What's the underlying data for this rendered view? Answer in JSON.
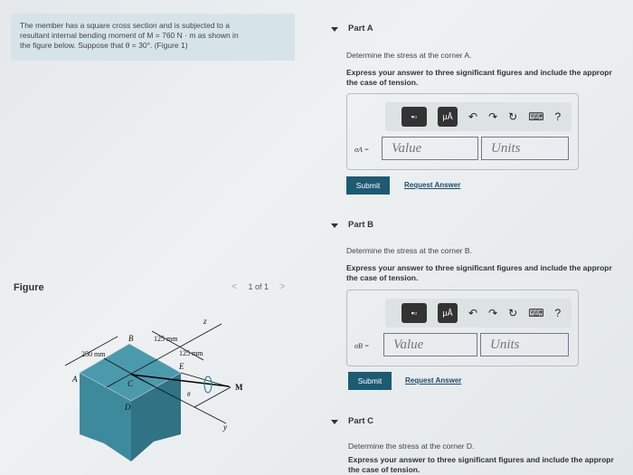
{
  "problem": {
    "text_line1": "The member has a square cross section and is subjected to a",
    "text_line2": "resultant internal bending moment of M = 760  N · m as shown in",
    "text_line3": "the figure below. Suppose that θ = 30°. (Figure 1)"
  },
  "figure": {
    "label": "Figure",
    "pager": "1 of 1",
    "labels": {
      "A": "A",
      "B": "B",
      "C": "C",
      "D": "D",
      "E": "E",
      "M": "M",
      "z": "z",
      "y": "y",
      "theta": "θ",
      "dim1": "250 mm",
      "dim2": "125 mm",
      "dim3": "125 mm"
    },
    "block_color": "#3d8a9c"
  },
  "toolbar": {
    "templates": "templates",
    "symbols": "μÅ",
    "undo": "↶",
    "redo": "↷",
    "reset": "↻",
    "keyboard": "⌨",
    "help": "?"
  },
  "parts": [
    {
      "title": "Part A",
      "question": "Determine the stress at the corner A.",
      "instructions_1": "Express your answer to three significant figures and include the appropr",
      "instructions_2": "the case of tension.",
      "var": "σA =",
      "value_placeholder": "Value",
      "units_placeholder": "Units",
      "submit": "Submit",
      "request": "Request Answer"
    },
    {
      "title": "Part B",
      "question": "Determine the stress at the corner B.",
      "instructions_1": "Express your answer to three significant figures and include the appropr",
      "instructions_2": "the case of tension.",
      "var": "σB =",
      "value_placeholder": "Value",
      "units_placeholder": "Units",
      "submit": "Submit",
      "request": "Request Answer"
    },
    {
      "title": "Part C",
      "question": "Determine the stress at the corner D.",
      "instructions_1": "Express your answer to three significant figures and include the appropr",
      "instructions_2": "the case of tension."
    }
  ],
  "colors": {
    "submit": "#1d5a73",
    "problem_bg": "#d6e4ea"
  }
}
